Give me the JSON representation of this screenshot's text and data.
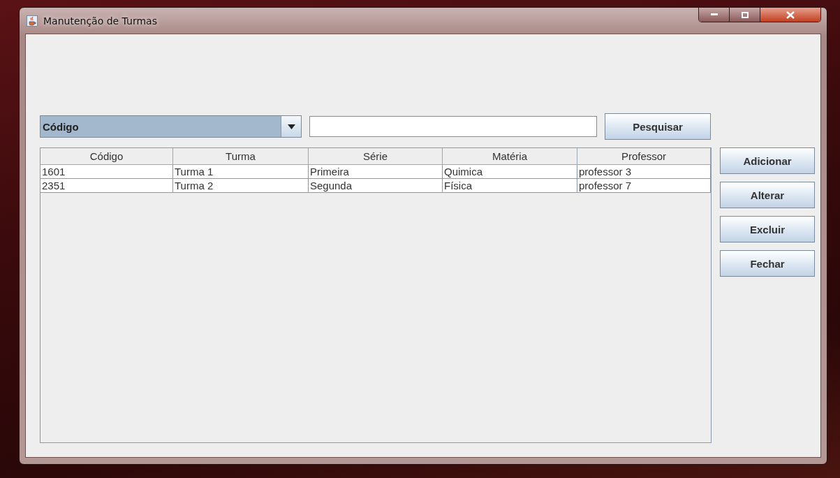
{
  "window": {
    "title": "Manutenção de Turmas"
  },
  "search": {
    "field": "Código",
    "button": "Pesquisar"
  },
  "table": {
    "columns": [
      "Código",
      "Turma",
      "Série",
      "Matéria",
      "Professor"
    ],
    "rows": [
      [
        "1601",
        "Turma 1",
        "Primeira",
        "Quimica",
        "professor 3"
      ],
      [
        "2351",
        "Turma 2",
        "Segunda",
        "Física",
        "professor 7"
      ]
    ]
  },
  "buttons": [
    "Adicionar",
    "Alterar",
    "Excluir",
    "Fechar"
  ]
}
